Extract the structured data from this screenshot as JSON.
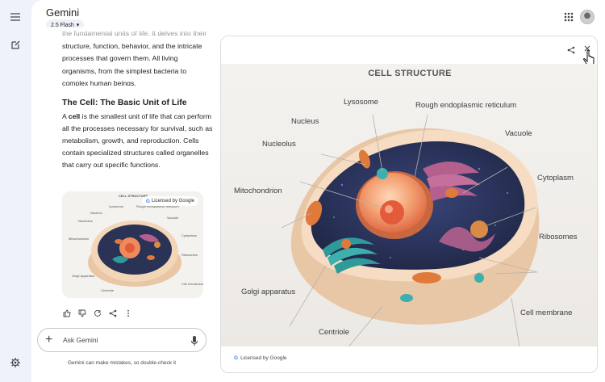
{
  "app": {
    "title": "Gemini",
    "model": "2.5 Flash"
  },
  "chat": {
    "intro_text": "the fundamental units of life. It delves into their structure, function, behavior, and the intricate processes that govern them. All living organisms, from the simplest bacteria to complex human beings,",
    "section_heading": "The Cell: The Basic Unit of Life",
    "body_prefix": "A ",
    "body_bold": "cell",
    "body_text": " is the smallest unit of life that can perform all the processes necessary for survival, such as metabolism, growth, and reproduction. Cells contain specialized structures called organelles that carry out specific functions.",
    "thumbnail_badge": "Licensed by Google",
    "thumb_labels": [
      "CELL STRUCTURE",
      "Lysosome",
      "Rough endoplasmic reticulum",
      "Nucleus",
      "Vacuole",
      "Nucleolus",
      "Cytoplasm",
      "Mitochondrion",
      "Ribosomes",
      "Golgi apparatus",
      "Cell membrane",
      "Centriole"
    ]
  },
  "input": {
    "placeholder": "Ask Gemini",
    "disclaimer": "Gemini can make mistakes, so double-check it"
  },
  "panel": {
    "footer": "Licensed by Google"
  },
  "diagram": {
    "title": "CELL STRUCTURE",
    "labels": {
      "lysosome": "Lysosome",
      "rer": "Rough endoplasmic reticulum",
      "nucleus": "Nucleus",
      "vacuole": "Vacuole",
      "nucleolus": "Nucleolus",
      "cytoplasm": "Cytoplasm",
      "mitochondrion": "Mitochondrion",
      "ribosomes": "Ribosomes",
      "golgi": "Golgi apparatus",
      "membrane": "Cell membrane",
      "centriole": "Centriole"
    }
  },
  "colors": {
    "accent_blue": "#4285f4",
    "cell_interior": "#2a3256",
    "nucleus": "#f08a5d",
    "membrane": "#f3d6b8"
  }
}
